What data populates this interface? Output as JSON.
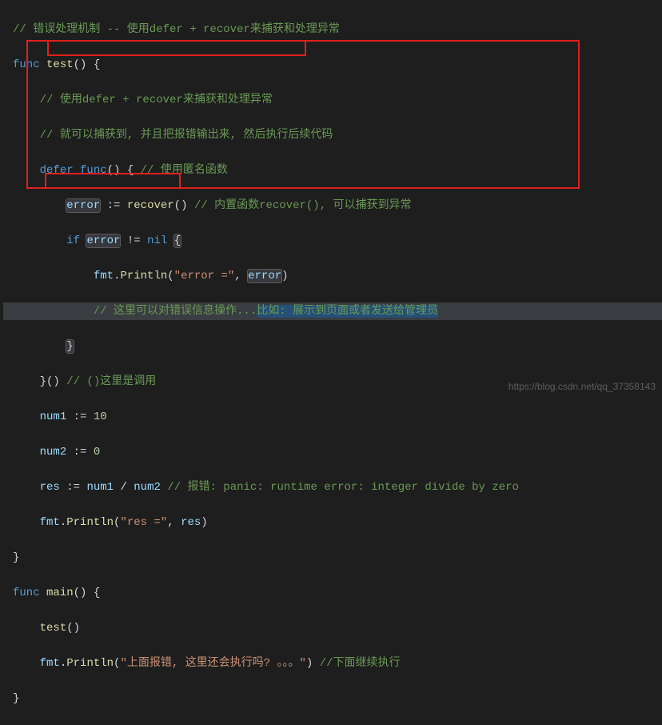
{
  "code": {
    "l1": {
      "c": "// 错误处理机制 -- 使用defer + recover来捕获和处理异常"
    },
    "l2": {
      "k1": "func",
      "name": "test",
      "p": "() {"
    },
    "l3": {
      "c": "// 使用defer + recover来捕获和处理异常"
    },
    "l4": {
      "c": "// 就可以捕获到, 并且把报错输出来, 然后执行后续代码"
    },
    "l5": {
      "k1": "defer",
      "k2": "func",
      "p": "() {",
      "c": " // 使用匿名函数"
    },
    "l6": {
      "id": "error",
      "op": ":=",
      "fn": "recover",
      "p": "()",
      "c": " // 内置函数recover(), 可以捕获到异常"
    },
    "l7": {
      "k1": "if",
      "id": "error",
      "op": "!=",
      "nil": "nil",
      "b": "{"
    },
    "l8": {
      "pkg": "fmt",
      "dot": ".",
      "fn": "Println",
      "p1": "(",
      "s": "\"error =\"",
      "comma": ", ",
      "id": "error",
      "p2": ")"
    },
    "l9": {
      "c": "// 这里可以对错误信息操作...",
      "hl": "比如: 展示到页面或者发送给管理员"
    },
    "l10": {
      "b": "}"
    },
    "l11": {
      "b": "}()",
      "c": " // ()这里是调用"
    },
    "l12": {
      "id": "num1",
      "op": ":=",
      "n": "10"
    },
    "l13": {
      "id": "num2",
      "op": ":=",
      "n": "0"
    },
    "l14": {
      "id": "res",
      "op": ":=",
      "id2": "num1",
      "div": " / ",
      "id3": "num2",
      "c": " // 报错: panic: runtime error: integer divide by zero"
    },
    "l15": {
      "pkg": "fmt",
      "dot": ".",
      "fn": "Println",
      "p1": "(",
      "s": "\"res =\"",
      "comma": ", ",
      "id": "res",
      "p2": ")"
    },
    "l16": {
      "b": "}"
    },
    "l17": {
      "k1": "func",
      "name": "main",
      "p": "() {"
    },
    "l18": {
      "fn": "test",
      "p": "()"
    },
    "l19": {
      "pkg": "fmt",
      "dot": ".",
      "fn": "Println",
      "p1": "(",
      "s": "\"上面报错, 这里还会执行吗? 。。。\"",
      "p2": ")",
      "c": " //下面继续执行"
    },
    "l20": {
      "b": "}"
    }
  },
  "watermark": "https://blog.csdn.net/qq_37358143"
}
